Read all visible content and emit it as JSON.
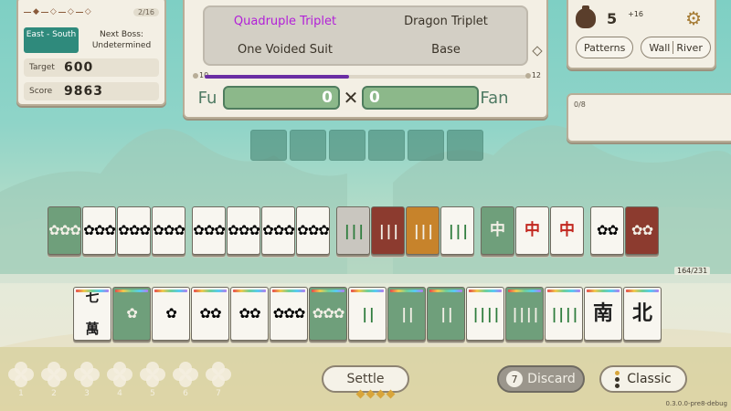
{
  "left_panel": {
    "round_badge": "2/16",
    "wind": "East - South",
    "next_boss_label": "Next Boss:",
    "next_boss_value": "Undetermined",
    "target_label": "Target",
    "target_value": "600",
    "score_label": "Score",
    "score_value": "9863"
  },
  "score_panel": {
    "patterns": [
      "Quadruple Triplet",
      "Dragon Triplet",
      "One Voided Suit",
      "Base"
    ],
    "progress_min": "10",
    "progress_max": "12",
    "progress_fraction": 0.45,
    "fu_label": "Fu",
    "fu_value": "0",
    "times": "✕",
    "fan_value": "0",
    "fan_label": "Fan"
  },
  "right_panel": {
    "money": "5",
    "money_bonus": "+16",
    "patterns_button": "Patterns",
    "wall_button": "Wall",
    "river_button": "River"
  },
  "river_panel": {
    "count": "0/8"
  },
  "tile_count": "164/231",
  "wall_tiles": [
    {
      "face": "✿✿✿",
      "kind": "pin",
      "color": "green"
    },
    {
      "face": "✿✿✿",
      "kind": "pin",
      "color": "white"
    },
    {
      "face": "✿✿✿",
      "kind": "pin",
      "color": "white"
    },
    {
      "face": "✿✿✿",
      "kind": "pin",
      "color": "white"
    },
    {
      "face": "",
      "kind": "gap"
    },
    {
      "face": "✿✿✿",
      "kind": "pin",
      "color": "white"
    },
    {
      "face": "✿✿✿",
      "kind": "pin",
      "color": "white"
    },
    {
      "face": "✿✿✿",
      "kind": "pin",
      "color": "white"
    },
    {
      "face": "✿✿✿",
      "kind": "pin",
      "color": "white"
    },
    {
      "face": "",
      "kind": "gap"
    },
    {
      "face": "|||",
      "kind": "bam",
      "color": "silver"
    },
    {
      "face": "|||",
      "kind": "bam",
      "color": "red"
    },
    {
      "face": "|||",
      "kind": "bam",
      "color": "orange"
    },
    {
      "face": "|||",
      "kind": "bam",
      "color": "white"
    },
    {
      "face": "",
      "kind": "gap"
    },
    {
      "face": "中",
      "kind": "dragon",
      "color": "green"
    },
    {
      "face": "中",
      "kind": "dragon",
      "color": "white"
    },
    {
      "face": "中",
      "kind": "dragon",
      "color": "white"
    },
    {
      "face": "",
      "kind": "gap"
    },
    {
      "face": "✿✿",
      "kind": "pin",
      "color": "white"
    },
    {
      "face": "✿✿",
      "kind": "pin",
      "color": "red"
    }
  ],
  "hand_tiles": [
    {
      "face": "七",
      "sub": "萬",
      "kind": "char",
      "color": "white"
    },
    {
      "face": "✿",
      "kind": "pin",
      "color": "green"
    },
    {
      "face": "✿",
      "kind": "pin",
      "color": "white"
    },
    {
      "face": "✿✿",
      "kind": "pin",
      "color": "white"
    },
    {
      "face": "✿✿",
      "kind": "pin",
      "color": "white"
    },
    {
      "face": "✿✿✿",
      "kind": "pin",
      "color": "white"
    },
    {
      "face": "✿✿✿",
      "kind": "pin",
      "color": "green"
    },
    {
      "face": "||",
      "kind": "bam",
      "color": "white"
    },
    {
      "face": "||",
      "kind": "bam",
      "color": "green"
    },
    {
      "face": "||",
      "kind": "bam",
      "color": "green"
    },
    {
      "face": "||||",
      "kind": "bam",
      "color": "white"
    },
    {
      "face": "||||",
      "kind": "bam",
      "color": "green"
    },
    {
      "face": "||||",
      "kind": "bam",
      "color": "white"
    },
    {
      "face": "南",
      "kind": "wind",
      "color": "white"
    },
    {
      "face": "北",
      "kind": "wind",
      "color": "white"
    }
  ],
  "discard_slots": [
    "1",
    "2",
    "3",
    "4",
    "5",
    "6",
    "7"
  ],
  "buttons": {
    "settle": "Settle",
    "discard_count": "7",
    "discard": "Discard",
    "classic": "Classic"
  },
  "version": "0.3.0.0-pre8-debug",
  "colors": {
    "accent_purple": "#b21fd8",
    "progress": "#6b2ea4",
    "fu_fan_green": "#8cb88a"
  }
}
